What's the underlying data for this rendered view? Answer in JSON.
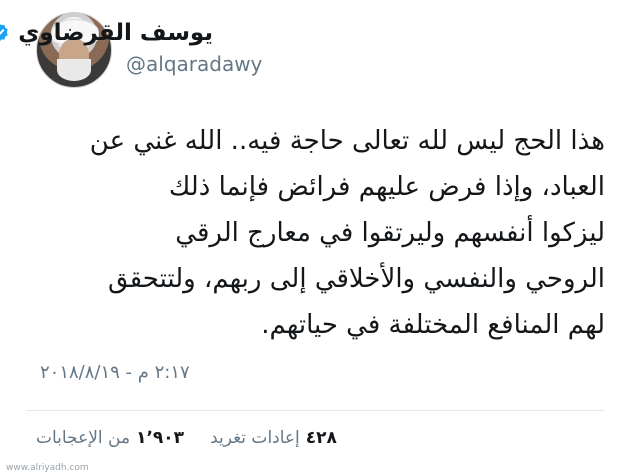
{
  "tweet": {
    "display_name": "يوسف القرضاوي",
    "handle": "@alqaradawy",
    "body": "هذا الحج ليس لله تعالى حاجة فيه.. الله غني عن\nالعباد، وإذا فرض عليهم فرائض فإنما ذلك\nليزكوا أنفسهم وليرتقوا في معارج الرقي\nالروحي والنفسي والأخلاقي إلى ربهم، ولتتحقق\nلهم المنافع المختلفة في حياتهم.",
    "timestamp": "٢:١٧ م - ٢٠١٨/٨/١٩",
    "stats": {
      "retweets_count": "٤٢٨",
      "retweets_label": "إعادات تغريد",
      "likes_count": "١٬٩٠٣",
      "likes_label": "من الإعجابات"
    }
  },
  "watermark": "www.alriyadh.com",
  "colors": {
    "verified_blue": "#1da1f2",
    "secondary_text": "#657786",
    "primary_text": "#14171a"
  },
  "icons": {
    "verified": "verified-badge-icon"
  }
}
